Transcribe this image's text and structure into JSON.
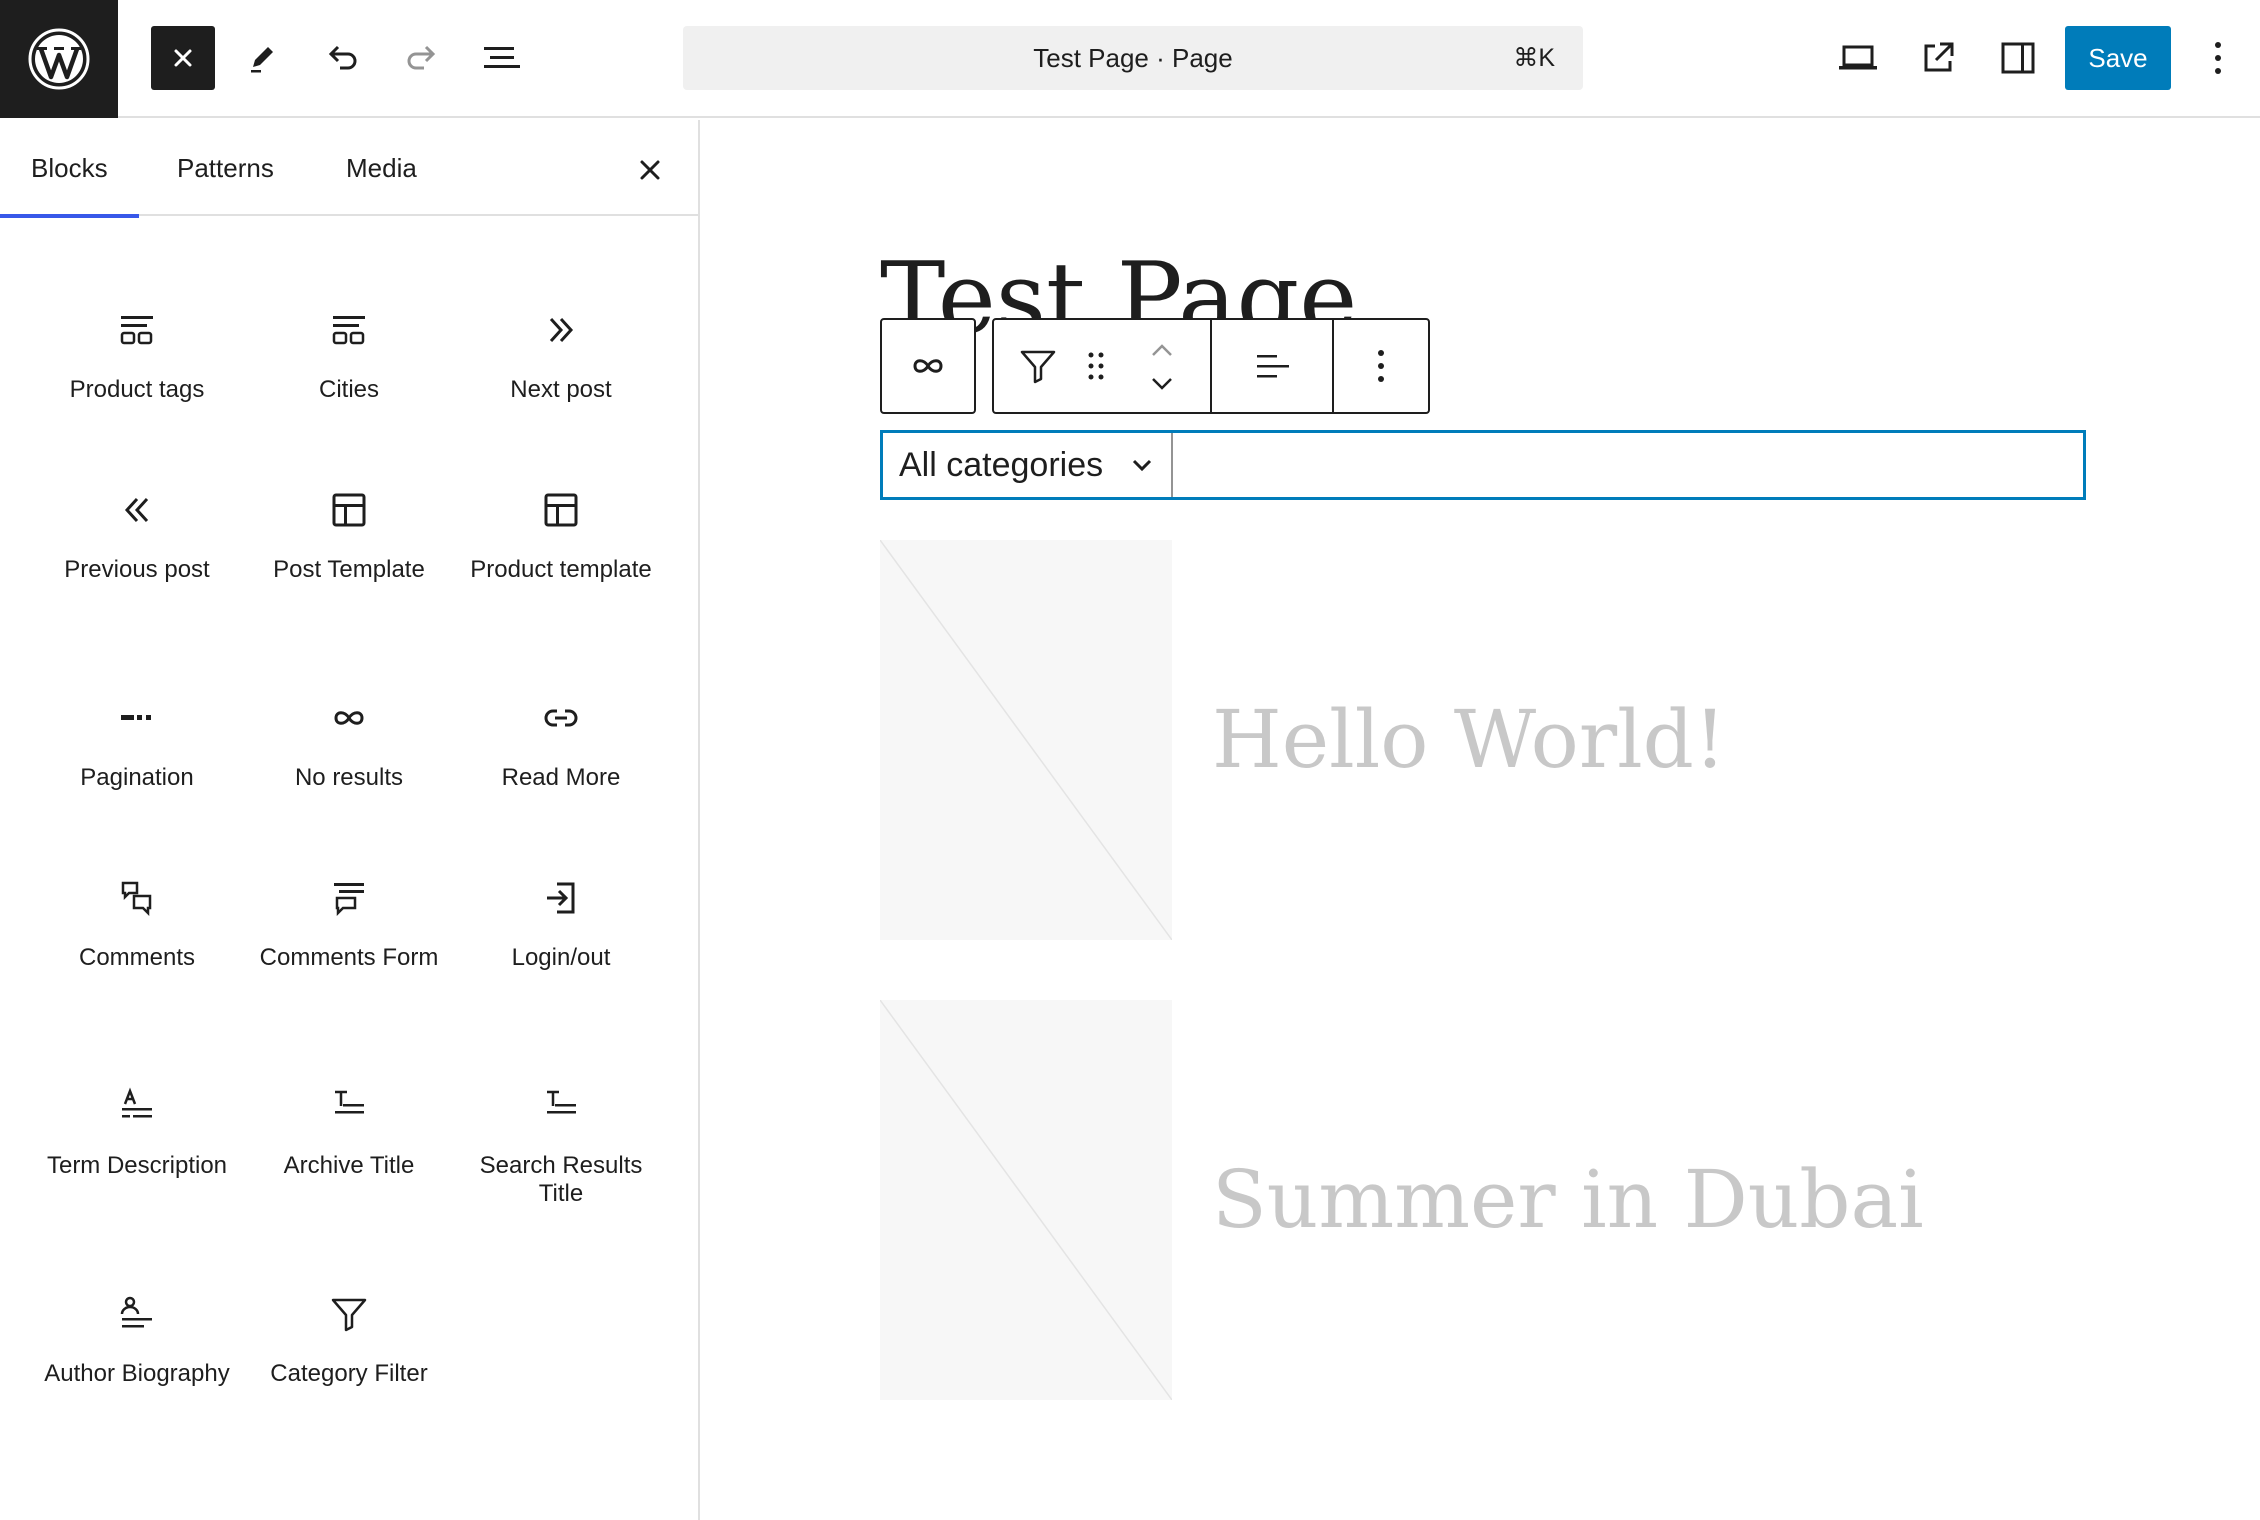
{
  "topbar": {
    "document_title": "Test Page · Page",
    "shortcut": "⌘K",
    "save_label": "Save"
  },
  "sidebar": {
    "tabs": [
      {
        "label": "Blocks",
        "active": true
      },
      {
        "label": "Patterns",
        "active": false
      },
      {
        "label": "Media",
        "active": false
      }
    ],
    "blocks": [
      {
        "label": "Product tags",
        "icon": "tag-cloud-icon"
      },
      {
        "label": "Cities",
        "icon": "tag-cloud-icon"
      },
      {
        "label": "Next post",
        "icon": "chevron-double-right-icon"
      },
      {
        "label": "Previous post",
        "icon": "chevron-double-left-icon"
      },
      {
        "label": "Post Template",
        "icon": "layout-icon"
      },
      {
        "label": "Product template",
        "icon": "layout-icon"
      },
      {
        "label": "Pagination",
        "icon": "pagination-icon"
      },
      {
        "label": "No results",
        "icon": "loop-icon"
      },
      {
        "label": "Read More",
        "icon": "link-icon"
      },
      {
        "label": "Comments",
        "icon": "comments-icon"
      },
      {
        "label": "Comments Form",
        "icon": "comment-form-icon"
      },
      {
        "label": "Login/out",
        "icon": "login-icon"
      },
      {
        "label": "Term Description",
        "icon": "term-description-icon"
      },
      {
        "label": "Archive Title",
        "icon": "title-icon"
      },
      {
        "label": "Search Results Title",
        "icon": "title-icon"
      },
      {
        "label": "Author Biography",
        "icon": "author-icon"
      },
      {
        "label": "Category Filter",
        "icon": "filter-icon"
      }
    ]
  },
  "canvas": {
    "page_title": "Test Page",
    "category_select": "All categories",
    "posts": [
      {
        "title": "Hello World!"
      },
      {
        "title": "Summer in Dubai"
      }
    ]
  },
  "colors": {
    "accent": "#007cba",
    "tab_indicator": "#3858e9",
    "dark": "#1e1e1e",
    "muted_title": "#c8c8c8"
  }
}
